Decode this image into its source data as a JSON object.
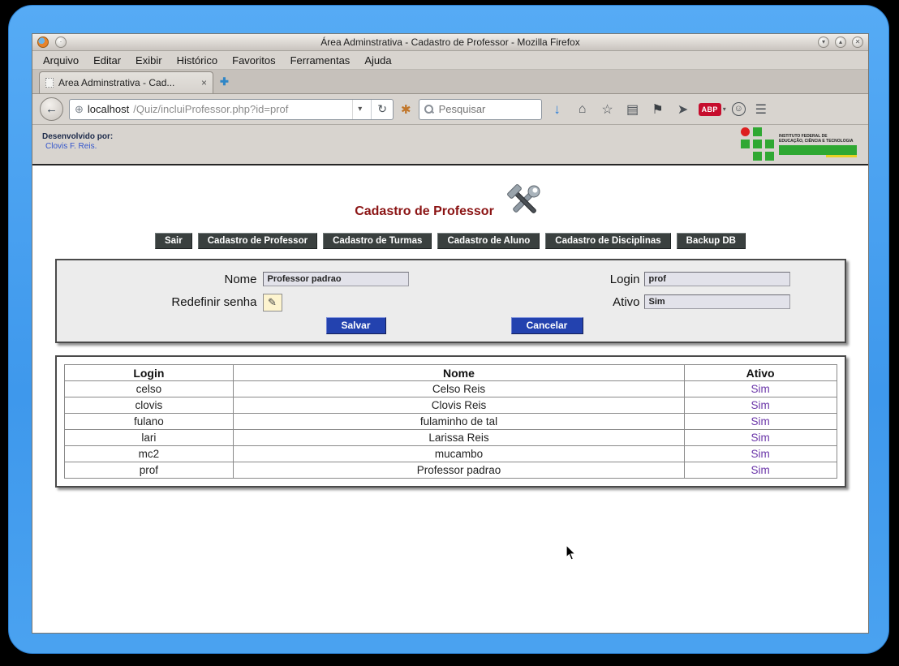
{
  "titlebar": {
    "title": "Área Adminstrativa - Cadastro de Professor - Mozilla Firefox"
  },
  "menubar": {
    "items": [
      "Arquivo",
      "Editar",
      "Exibir",
      "Histórico",
      "Favoritos",
      "Ferramentas",
      "Ajuda"
    ]
  },
  "tabs": {
    "active_label": "Area Adminstrativa - Cad...",
    "close_glyph": "×",
    "new_tab_glyph": "✚"
  },
  "toolbar": {
    "url_host": "localhost",
    "url_path": "/Quiz/incluiProfessor.php?id=prof",
    "search_placeholder": "Pesquisar",
    "abp_label": "ABP"
  },
  "icons": {
    "back": "←",
    "dropdown": "▾",
    "reload": "↻",
    "bookmark_star": "✱",
    "globe": "⊕",
    "downloads": "↓",
    "home": "⌂",
    "star": "☆",
    "library": "▤",
    "pocket": "⚑",
    "send": "➤",
    "smiley": "☺",
    "menu": "☰",
    "pencil": "✎",
    "win_min": "▾",
    "win_max": "▴",
    "win_close": "✕"
  },
  "page_header": {
    "developed_by": "Desenvolvido por:",
    "developer_link": "Clovis F. Reis.",
    "logo_line1": "INSTITUTO FEDERAL DE",
    "logo_line2": "EDUCAÇÃO, CIÊNCIA E TECNOLOGIA"
  },
  "content": {
    "heading": "Cadastro de Professor",
    "nav_buttons": [
      "Sair",
      "Cadastro de Professor",
      "Cadastro de Turmas",
      "Cadastro de Aluno",
      "Cadastro de Disciplinas",
      "Backup DB"
    ],
    "form": {
      "nome_label": "Nome",
      "nome_value": "Professor padrao",
      "login_label": "Login",
      "login_value": "prof",
      "senha_label": "Redefinir senha",
      "ativo_label": "Ativo",
      "ativo_value": "Sim",
      "save": "Salvar",
      "cancel": "Cancelar"
    },
    "table": {
      "headers": [
        "Login",
        "Nome",
        "Ativo"
      ],
      "rows": [
        {
          "login": "celso",
          "nome": "Celso Reis",
          "ativo": "Sim"
        },
        {
          "login": "clovis",
          "nome": "Clovis Reis",
          "ativo": "Sim"
        },
        {
          "login": "fulano",
          "nome": "fulaminho de tal",
          "ativo": "Sim"
        },
        {
          "login": "lari",
          "nome": "Larissa Reis",
          "ativo": "Sim"
        },
        {
          "login": "mc2",
          "nome": "mucambo",
          "ativo": "Sim"
        },
        {
          "login": "prof",
          "nome": "Professor padrao",
          "ativo": "Sim"
        }
      ]
    }
  }
}
